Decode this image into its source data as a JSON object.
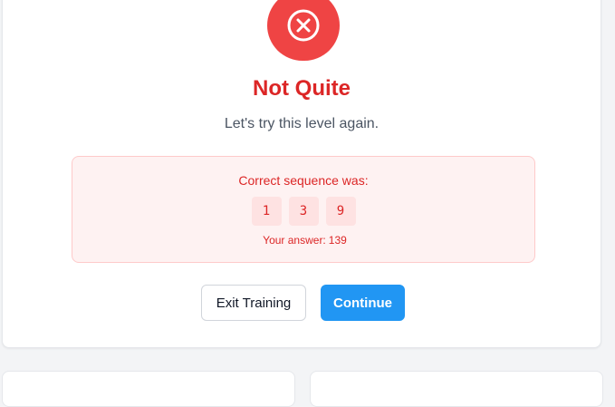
{
  "result": {
    "status_icon": "x-circle-icon",
    "status_color": "#ef4444",
    "title": "Not Quite",
    "subtitle": "Let's try this level again.",
    "title_color": "#dc2626"
  },
  "answer_box": {
    "label": "Correct sequence was:",
    "sequence": [
      "1",
      "3",
      "9"
    ],
    "your_answer_label": "Your answer:",
    "your_answer_value": "139"
  },
  "actions": {
    "exit_label": "Exit Training",
    "continue_label": "Continue",
    "primary_color": "#2196f3"
  }
}
